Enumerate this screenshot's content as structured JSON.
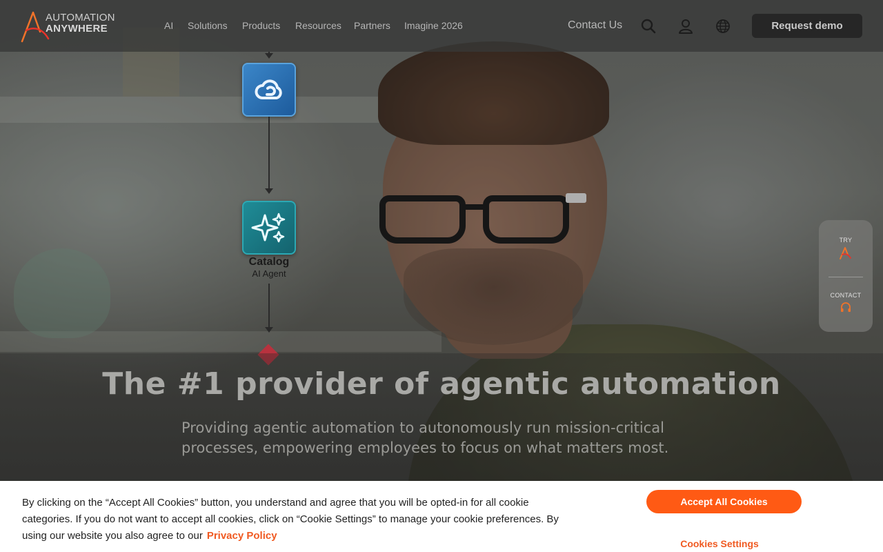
{
  "brand": {
    "line1": "AUTOMATION",
    "line2": "ANYWHERE",
    "logo_color": "#f0732a"
  },
  "nav": {
    "items": [
      {
        "label": "AI"
      },
      {
        "label": "Solutions"
      },
      {
        "label": "Products"
      },
      {
        "label": "Resources"
      },
      {
        "label": "Partners"
      },
      {
        "label": "Imagine 2026"
      }
    ],
    "contact_label": "Contact Us",
    "icons": [
      "search-icon",
      "user-icon",
      "globe-icon"
    ],
    "demo_label": "Request demo"
  },
  "workflow": {
    "nodes": [
      {
        "icon": "cloud-icon"
      },
      {
        "icon": "sparkles-icon",
        "title": "Catalog",
        "subtitle": "AI Agent"
      }
    ]
  },
  "side_widget": {
    "try_label": "TRY",
    "contact_label": "CONTACT"
  },
  "hero": {
    "title": "The #1 provider of agentic automation",
    "subtitle": "Providing agentic automation to autonomously run mission-critical processes, empowering employees to focus on what matters most."
  },
  "cookie": {
    "text": "By clicking on the “Accept All Cookies” button, you understand and agree that you will be opted-in for all cookie categories. If you do not want to accept all cookies, click on “Cookie Settings” to manage your cookie preferences. By using our website you also agree to our",
    "policy_label": "Privacy Policy",
    "accept_label": "Accept All Cookies",
    "settings_label": "Cookies Settings",
    "accent": "#ff5a14"
  }
}
